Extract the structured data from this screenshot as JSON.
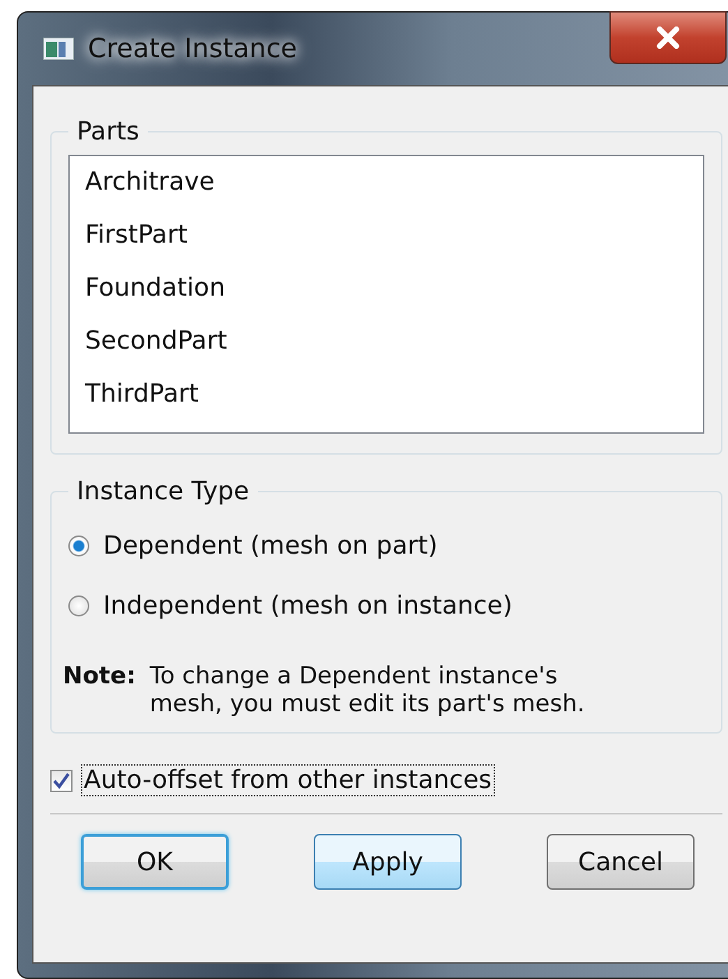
{
  "window": {
    "title": "Create Instance"
  },
  "parts": {
    "label": "Parts",
    "items": [
      {
        "name": "Architrave",
        "selected": false
      },
      {
        "name": "FirstPart",
        "selected": false
      },
      {
        "name": "Foundation",
        "selected": false
      },
      {
        "name": "SecondPart",
        "selected": false
      },
      {
        "name": "ThirdPart",
        "selected": false
      }
    ]
  },
  "instance_type": {
    "label": "Instance Type",
    "options": [
      {
        "label": "Dependent (mesh on part)",
        "selected": true
      },
      {
        "label": "Independent (mesh on instance)",
        "selected": false
      }
    ],
    "note_label": "Note:",
    "note_text": "To change a Dependent instance's mesh, you must edit its part's mesh."
  },
  "auto_offset": {
    "label": "Auto-offset from other instances",
    "checked": true,
    "focused": true
  },
  "buttons": [
    {
      "label": "OK",
      "kind": "default"
    },
    {
      "label": "Apply",
      "kind": "hover"
    },
    {
      "label": "Cancel",
      "kind": "normal"
    }
  ]
}
